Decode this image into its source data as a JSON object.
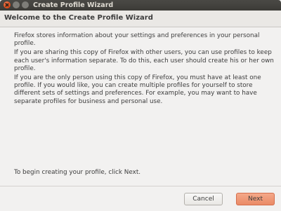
{
  "window": {
    "title": "Create Profile Wizard"
  },
  "header": {
    "title": "Welcome to the Create Profile Wizard"
  },
  "content": {
    "paragraphs": [
      "Firefox stores information about your settings and preferences in your personal profile.",
      "If you are sharing this copy of Firefox with other users, you can use profiles to keep each user's information separate. To do this, each user should create his or her own profile.",
      "If you are the only person using this copy of Firefox, you must have at least one profile. If you would like, you can create multiple profiles for yourself to store different sets of settings and preferences. For example, you may want to have separate profiles for business and personal use."
    ],
    "footer": "To begin creating your profile, click Next."
  },
  "buttons": {
    "cancel": "Cancel",
    "next": "Next"
  },
  "colors": {
    "titlebar": "#3c3b37",
    "close_button": "#df4a16",
    "next_button": "#ea8a66",
    "window_background": "#f2f1f0"
  }
}
